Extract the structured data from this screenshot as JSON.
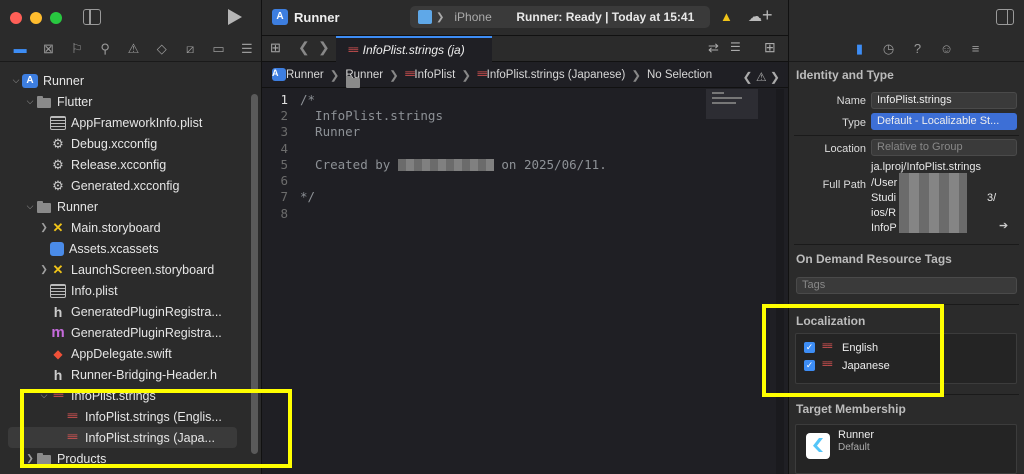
{
  "sidebar": {
    "tree": [
      {
        "label": "Runner",
        "icon": "project-icon",
        "indent": 0,
        "disclosure": "open"
      },
      {
        "label": "Flutter",
        "icon": "folder-icon",
        "indent": 1,
        "disclosure": "open"
      },
      {
        "label": "AppFrameworkInfo.plist",
        "icon": "plist-icon",
        "indent": 2,
        "disclosure": ""
      },
      {
        "label": "Debug.xcconfig",
        "icon": "xcconfig-icon",
        "indent": 2,
        "disclosure": ""
      },
      {
        "label": "Release.xcconfig",
        "icon": "xcconfig-icon",
        "indent": 2,
        "disclosure": ""
      },
      {
        "label": "Generated.xcconfig",
        "icon": "xcconfig-icon",
        "indent": 2,
        "disclosure": ""
      },
      {
        "label": "Runner",
        "icon": "folder-icon",
        "indent": 1,
        "disclosure": "open"
      },
      {
        "label": "Main.storyboard",
        "icon": "storyboard-icon",
        "indent": 2,
        "disclosure": "closed"
      },
      {
        "label": "Assets.xcassets",
        "icon": "assets-icon",
        "indent": 2,
        "disclosure": ""
      },
      {
        "label": "LaunchScreen.storyboard",
        "icon": "storyboard-icon",
        "indent": 2,
        "disclosure": "closed"
      },
      {
        "label": "Info.plist",
        "icon": "plist-icon",
        "indent": 2,
        "disclosure": ""
      },
      {
        "label": "GeneratedPluginRegistra...",
        "icon": "header-icon",
        "indent": 2,
        "disclosure": ""
      },
      {
        "label": "GeneratedPluginRegistra...",
        "icon": "objc-m-icon",
        "indent": 2,
        "disclosure": ""
      },
      {
        "label": "AppDelegate.swift",
        "icon": "swift-icon",
        "indent": 2,
        "disclosure": ""
      },
      {
        "label": "Runner-Bridging-Header.h",
        "icon": "header-icon",
        "indent": 2,
        "disclosure": ""
      },
      {
        "label": "InfoPlist.strings",
        "icon": "strings-icon",
        "indent": 2,
        "disclosure": "open"
      },
      {
        "label": "InfoPlist.strings (Englis...",
        "icon": "strings-icon",
        "indent": 3,
        "disclosure": ""
      },
      {
        "label": "InfoPlist.strings (Japa...",
        "icon": "strings-icon",
        "indent": 3,
        "disclosure": "",
        "selected": true
      },
      {
        "label": "Products",
        "icon": "folder-icon",
        "indent": 1,
        "disclosure": "closed"
      }
    ]
  },
  "toolbar": {
    "scheme_name": "Runner",
    "device": "iPhone",
    "status": "Runner: Ready | Today at 15:41"
  },
  "editor": {
    "tab_title": "InfoPlist.strings (ja)",
    "jumpbar": [
      "Runner",
      "Runner",
      "InfoPlist",
      "InfoPlist.strings (Japanese)",
      "No Selection"
    ],
    "lines": [
      {
        "n": "1",
        "text": "/*"
      },
      {
        "n": "2",
        "text": "  InfoPlist.strings"
      },
      {
        "n": "3",
        "text": "  Runner"
      },
      {
        "n": "4",
        "text": ""
      },
      {
        "n": "5",
        "pre": "  Created by ",
        "post": " on 2025/06/11."
      },
      {
        "n": "6",
        "text": ""
      },
      {
        "n": "7",
        "text": "*/"
      },
      {
        "n": "8",
        "text": ""
      }
    ]
  },
  "inspector": {
    "identity_title": "Identity and Type",
    "name_label": "Name",
    "name_value": "InfoPlist.strings",
    "type_label": "Type",
    "type_value": "Default - Localizable St...",
    "location_label": "Location",
    "location_value": "Relative to Group",
    "location_path": "ja.lproj/InfoPlist.strings",
    "fullpath_label": "Full Path",
    "fullpath_lines": [
      "/User",
      "Studi",
      "ios/R",
      "InfoP"
    ],
    "fullpath_tail": "3/",
    "odr_title": "On Demand Resource Tags",
    "tags_placeholder": "Tags",
    "localization_title": "Localization",
    "languages": [
      {
        "label": "English",
        "checked": true
      },
      {
        "label": "Japanese",
        "checked": true
      }
    ],
    "target_title": "Target Membership",
    "target_name": "Runner",
    "target_sub": "Default"
  },
  "colors": {
    "highlight": "#ffff00",
    "accent": "#3d8df5"
  }
}
